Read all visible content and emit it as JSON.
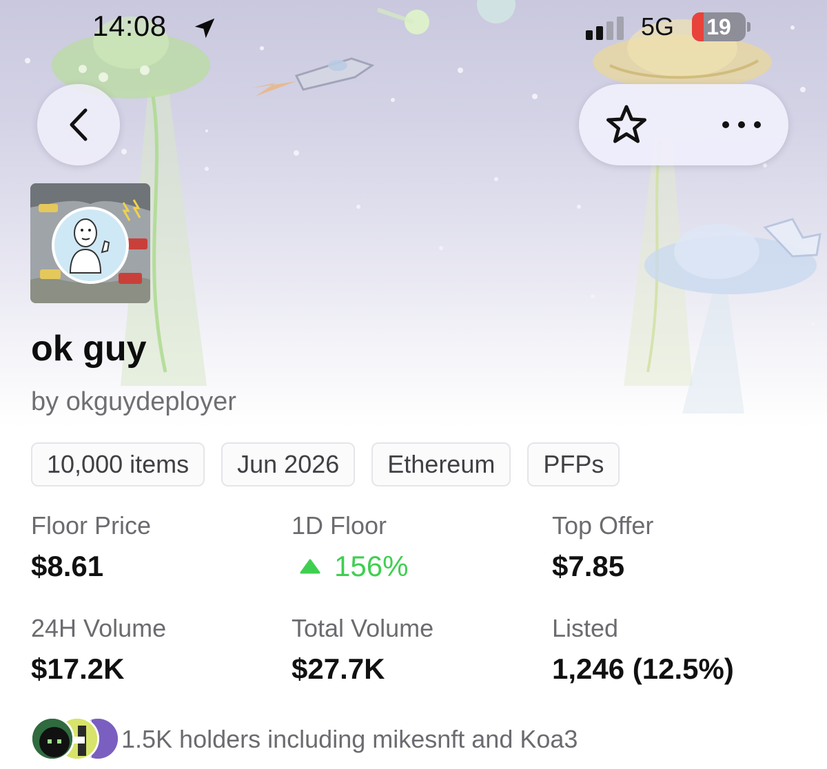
{
  "status_bar": {
    "time": "14:08",
    "network": "5G",
    "battery": "19"
  },
  "collection": {
    "name": "ok guy",
    "creator": "by okguydeployer",
    "tags": [
      "10,000 items",
      "Jun 2026",
      "Ethereum",
      "PFPs"
    ]
  },
  "stats": {
    "floor_price": {
      "label": "Floor Price",
      "value": "$8.61"
    },
    "one_day_floor": {
      "label": "1D Floor",
      "value": "156%",
      "trend": "up"
    },
    "top_offer": {
      "label": "Top Offer",
      "value": "$7.85"
    },
    "volume_24h": {
      "label": "24H Volume",
      "value": "$17.2K"
    },
    "total_volume": {
      "label": "Total Volume",
      "value": "$27.7K"
    },
    "listed": {
      "label": "Listed",
      "value": "1,246 (12.5%)"
    }
  },
  "holders": {
    "text": "1.5K holders including mikesnft and Koa3"
  },
  "icons": {
    "back": "chevron-left-icon",
    "favorite": "star-icon",
    "more": "ellipsis-icon",
    "trend": "triangle-up-icon",
    "location": "location-arrow-icon"
  },
  "colors": {
    "positive": "#3fcf50",
    "battery_low": "#e8423b"
  }
}
